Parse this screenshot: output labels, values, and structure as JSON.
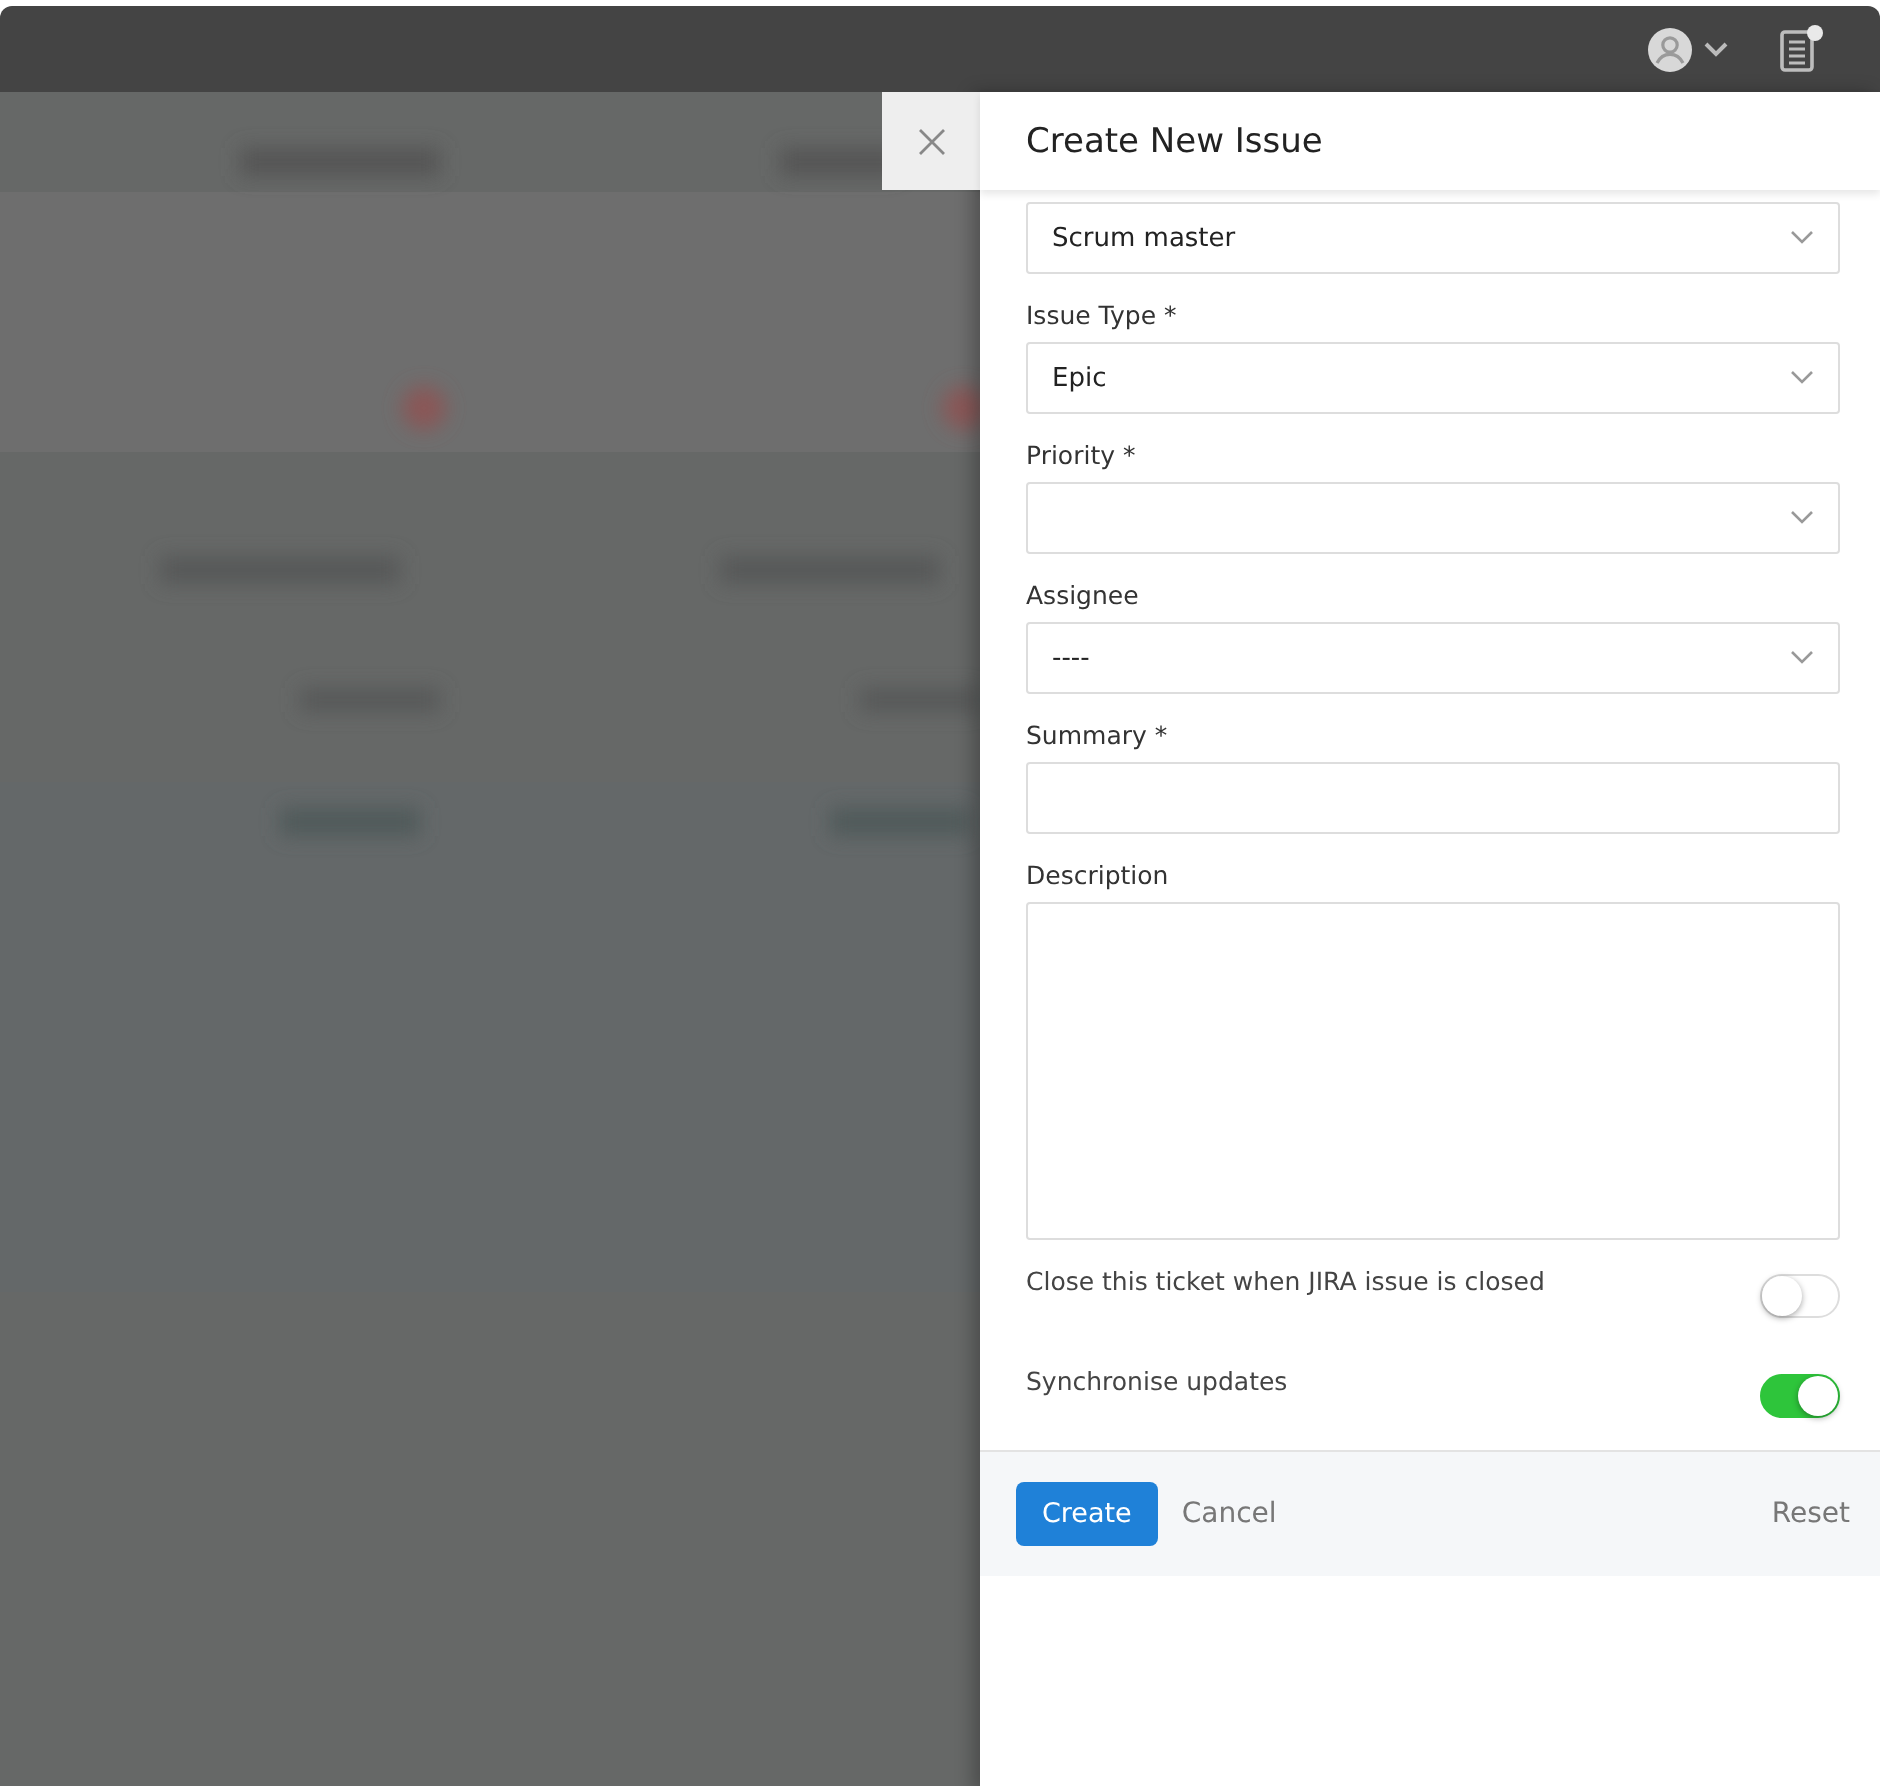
{
  "panel": {
    "title": "Create New Issue"
  },
  "fields": [
    {
      "kind": "select",
      "value": "Scrum master"
    },
    {
      "kind": "select",
      "label": "Issue Type *",
      "value": "Epic"
    },
    {
      "kind": "select",
      "label": "Priority *"
    },
    {
      "kind": "select",
      "label": "Assignee",
      "value": "----"
    },
    {
      "kind": "text",
      "label": "Summary *"
    },
    {
      "kind": "textarea",
      "label": "Description"
    }
  ],
  "toggles": [
    {
      "label": "Close this ticket when JIRA issue is closed",
      "on": false
    },
    {
      "label": "Synchronise updates",
      "on": true
    }
  ],
  "actions": {
    "primary": "Create",
    "secondary": "Cancel",
    "reset": "Reset"
  }
}
